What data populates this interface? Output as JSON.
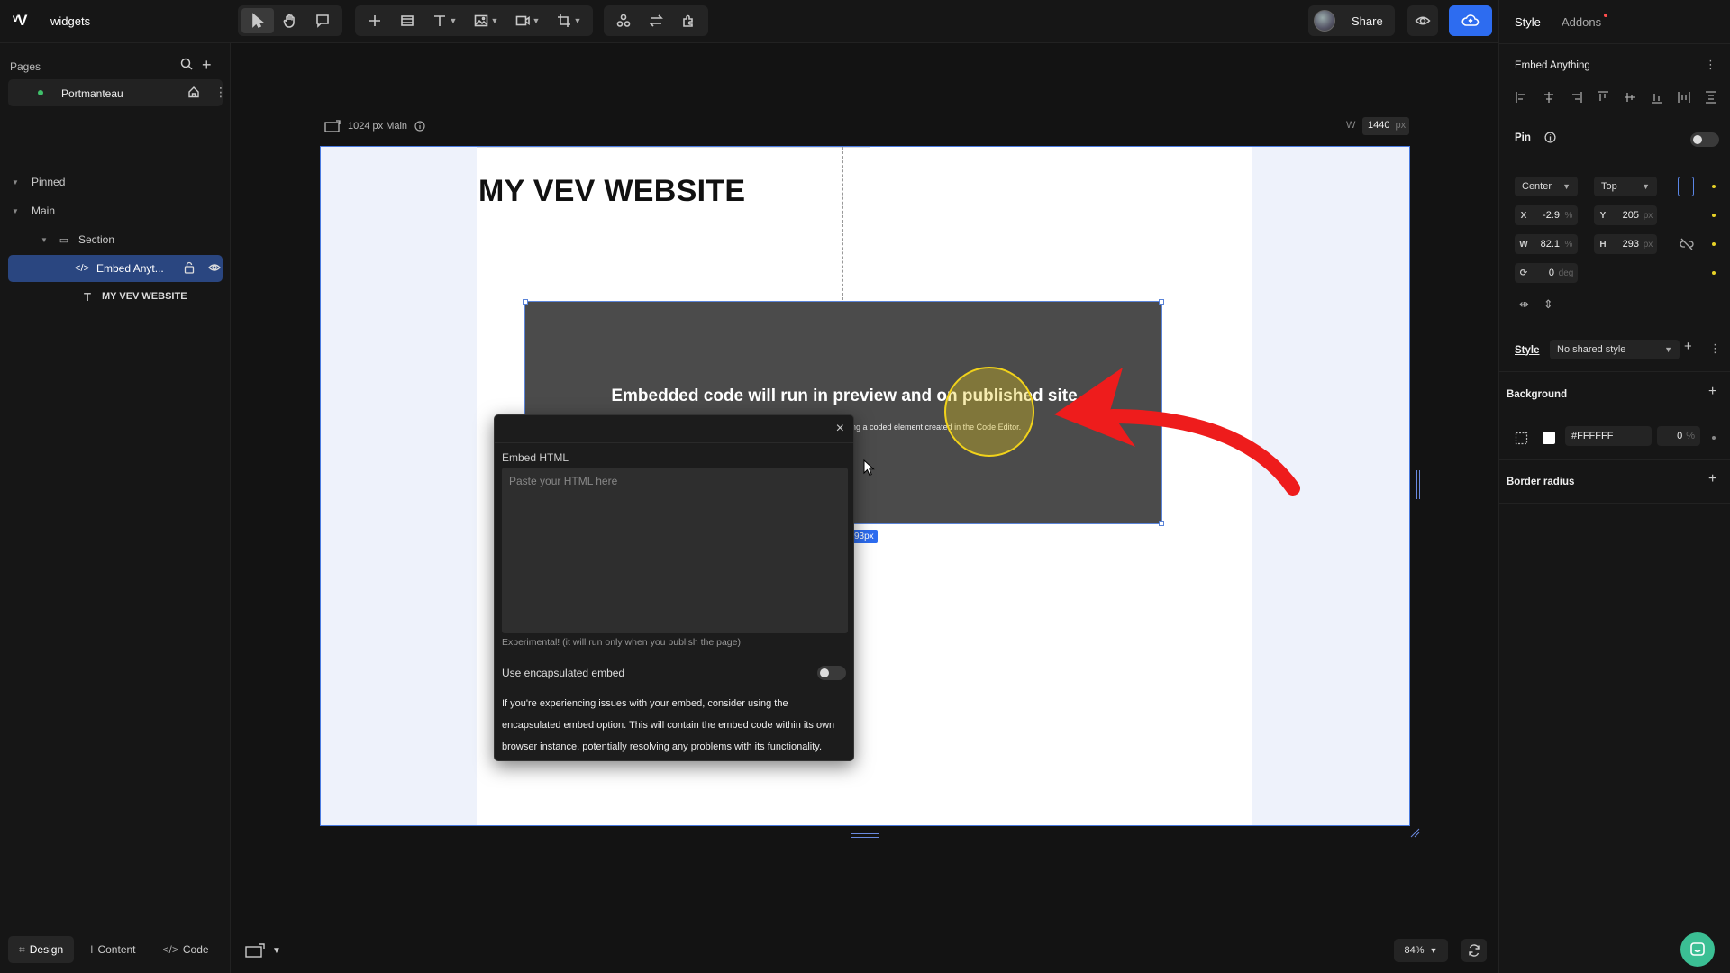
{
  "app": {
    "logo": "VEV",
    "project_name": "widgets"
  },
  "toolbar": {
    "tools": [
      "select-icon",
      "hand-icon",
      "comment-icon",
      "add-icon",
      "frame-icon",
      "text-icon",
      "image-icon",
      "video-icon",
      "crop-icon",
      "component-icon",
      "swap-icon",
      "plugin-icon"
    ],
    "share_label": "Share"
  },
  "pages": {
    "header": "Pages",
    "items": [
      {
        "name": "Portmanteau",
        "active": true
      }
    ]
  },
  "layers": {
    "pinned": "Pinned",
    "main": "Main",
    "section": "Section",
    "embed": "Embed Anyt...",
    "text": "MY VEV WEBSITE"
  },
  "bottom_tabs": {
    "design": "Design",
    "content": "Content",
    "code": "Code"
  },
  "canvas": {
    "breakpoint_label": "1024 px Main",
    "width_label": "W",
    "width_value": "1440",
    "width_unit": "px",
    "site_title": "MY VEV WEBSITE",
    "embed_heading": "Embedded code will run in preview and on published site",
    "embed_subtext": "ing a coded element created in the Code Editor.",
    "size_badge": "93px",
    "zoom": "84%"
  },
  "embed_modal": {
    "label": "Embed HTML",
    "placeholder": "Paste your HTML here",
    "experimental_note": "Experimental! (it will run only when you publish the page)",
    "encapsulated_label": "Use encapsulated embed",
    "encapsulated_enabled": false,
    "help_text": "If you're experiencing issues with your embed, consider using the encapsulated embed option. This will contain the embed code within its own browser instance, potentially resolving any problems with its functionality."
  },
  "right_panel": {
    "tabs": {
      "style": "Style",
      "addons": "Addons"
    },
    "element_name": "Embed Anything",
    "pin_label": "Pin",
    "pin_enabled": false,
    "pin_horizontal": "Center",
    "pin_vertical": "Top",
    "x": {
      "label": "X",
      "value": "-2.9",
      "unit": "%"
    },
    "y": {
      "label": "Y",
      "value": "205",
      "unit": "px"
    },
    "w": {
      "label": "W",
      "value": "82.1",
      "unit": "%"
    },
    "h": {
      "label": "H",
      "value": "293",
      "unit": "px"
    },
    "rotation": {
      "value": "0",
      "unit": "deg"
    },
    "style_label": "Style",
    "style_value": "No shared style",
    "background_label": "Background",
    "background_hex": "#FFFFFF",
    "background_alpha": "0",
    "background_alpha_unit": "%",
    "border_radius_label": "Border radius"
  },
  "colors": {
    "accent": "#2d6cf0",
    "highlight": "#f1d21a",
    "arrow": "#ee1c1c",
    "status_green": "#3fbf6a"
  }
}
